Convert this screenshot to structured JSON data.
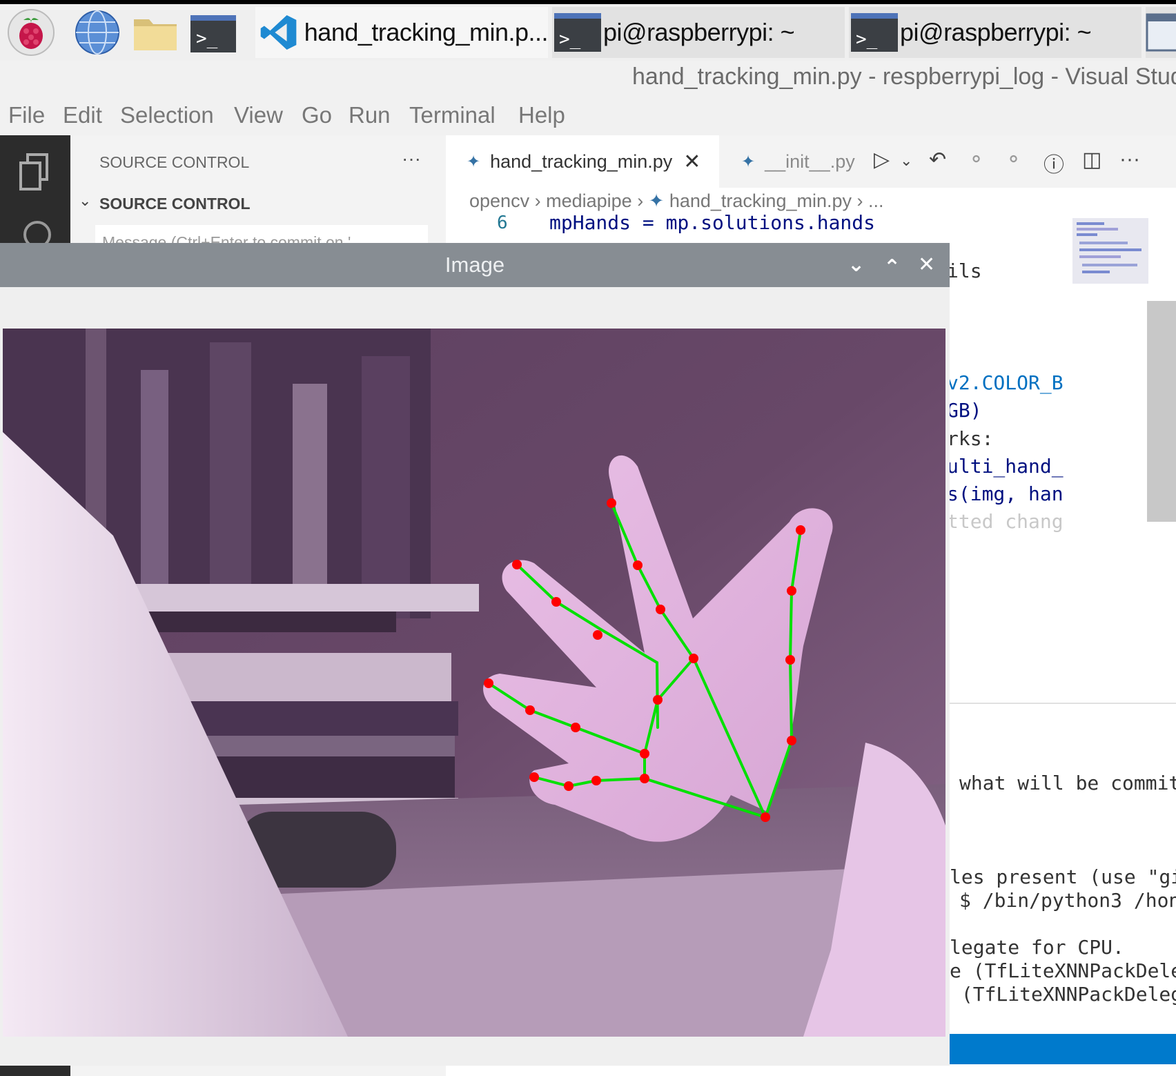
{
  "taskbar": {
    "items": [
      {
        "label": "hand_tracking_min.p..."
      },
      {
        "label": "pi@raspberrypi: ~"
      },
      {
        "label": "pi@raspberrypi: ~"
      }
    ]
  },
  "window_title": "hand_tracking_min.py - respberrypi_log - Visual Stud",
  "menu": [
    "File",
    "Edit",
    "Selection",
    "View",
    "Go",
    "Run",
    "Terminal",
    "Help"
  ],
  "sidebar": {
    "header": "SOURCE CONTROL",
    "more": "···",
    "section": "SOURCE CONTROL",
    "commit_placeholder": "Message (Ctrl+Enter to commit on '"
  },
  "editor": {
    "tabs": [
      {
        "label": "hand_tracking_min.py"
      },
      {
        "label": "__init__.py"
      }
    ],
    "breadcrumb": [
      "opencv",
      "mediapipe",
      "hand_tracking_min.py",
      "..."
    ],
    "line_number": "6",
    "code_line": "mpHands = mp.solutions.hands",
    "code_fragments": [
      "ils",
      "v2.COLOR_B",
      "GB)",
      "rks:",
      "ulti_hand_",
      "s(img, han",
      "tted chang"
    ]
  },
  "terminal": {
    "lines": [
      "what will be commit",
      "les present (use \"gi",
      "$ /bin/python3 /hon",
      "legate for CPU.",
      "e (TfLiteXNNPackDele",
      " (TfLiteXNNPackDeleg"
    ]
  },
  "image_window": {
    "title": "Image",
    "landmarks_color": "#ff0000",
    "connections_color": "#00e000"
  }
}
